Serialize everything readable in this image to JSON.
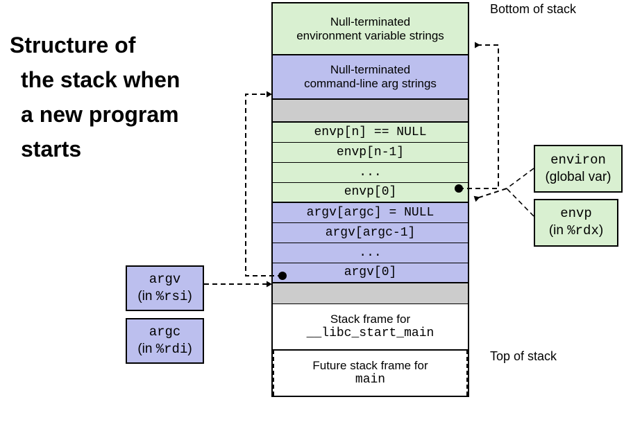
{
  "title": {
    "line1": "Structure of",
    "line2": "the stack when",
    "line3": "a new program",
    "line4": "starts"
  },
  "labels": {
    "bottom_of_stack": "Bottom of stack",
    "top_of_stack": "Top of stack"
  },
  "stack": {
    "rows": [
      {
        "id": "env-strings",
        "text_line1": "Null-terminated",
        "text_line2": "environment variable strings",
        "color": "#d9f0d1",
        "font": "sans"
      },
      {
        "id": "cmd-strings",
        "text_line1": "Null-terminated",
        "text_line2": "command-line arg strings",
        "color": "#bcbfee",
        "font": "sans"
      },
      {
        "id": "gap-upper",
        "text_line1": "",
        "text_line2": "",
        "color": "#cccccc",
        "font": "sans"
      },
      {
        "id": "envp-n",
        "text_line1": "envp[n] == NULL",
        "text_line2": "",
        "color": "#d9f0d1",
        "font": "mono"
      },
      {
        "id": "envp-n-1",
        "text_line1": "envp[n-1]",
        "text_line2": "",
        "color": "#d9f0d1",
        "font": "mono"
      },
      {
        "id": "envp-ellipsis",
        "text_line1": "...",
        "text_line2": "",
        "color": "#d9f0d1",
        "font": "mono"
      },
      {
        "id": "envp-0",
        "text_line1": "envp[0]",
        "text_line2": "",
        "color": "#d9f0d1",
        "font": "mono"
      },
      {
        "id": "argv-argc",
        "text_line1": "argv[argc] = NULL",
        "text_line2": "",
        "color": "#bcbfee",
        "font": "mono"
      },
      {
        "id": "argv-argc-1",
        "text_line1": "argv[argc-1]",
        "text_line2": "",
        "color": "#bcbfee",
        "font": "mono"
      },
      {
        "id": "argv-ellipsis",
        "text_line1": "...",
        "text_line2": "",
        "color": "#bcbfee",
        "font": "mono"
      },
      {
        "id": "argv-0",
        "text_line1": "argv[0]",
        "text_line2": "",
        "color": "#bcbfee",
        "font": "mono"
      },
      {
        "id": "gap-lower",
        "text_line1": "",
        "text_line2": "",
        "color": "#cccccc",
        "font": "sans"
      },
      {
        "id": "frame-libc",
        "text_line1": "Stack frame for",
        "text_line2": "__libc_start_main",
        "color": "#ffffff",
        "font": "sans"
      },
      {
        "id": "frame-main",
        "text_line1": "Future stack frame for",
        "text_line2": "main",
        "color": "#ffffff",
        "font": "sans"
      }
    ]
  },
  "side_boxes": {
    "environ": {
      "name": "environ",
      "detail": "(global var)",
      "color": "#d9f0d1"
    },
    "envp": {
      "name": "envp",
      "detail_prefix": "(in ",
      "register": "%rdx",
      "detail_suffix": ")",
      "color": "#d9f0d1"
    },
    "argv": {
      "name": "argv",
      "detail_prefix": "(in ",
      "register": "%rsi",
      "detail_suffix": ")",
      "color": "#bcbfee"
    },
    "argc": {
      "name": "argc",
      "detail_prefix": "(in ",
      "register": "%rdi",
      "detail_suffix": ")",
      "color": "#bcbfee"
    }
  },
  "colors": {
    "env_green": "#d9f0d1",
    "arg_purple": "#bcbfee",
    "gap_gray": "#cccccc",
    "frame_white": "#ffffff",
    "outline": "#000000"
  }
}
